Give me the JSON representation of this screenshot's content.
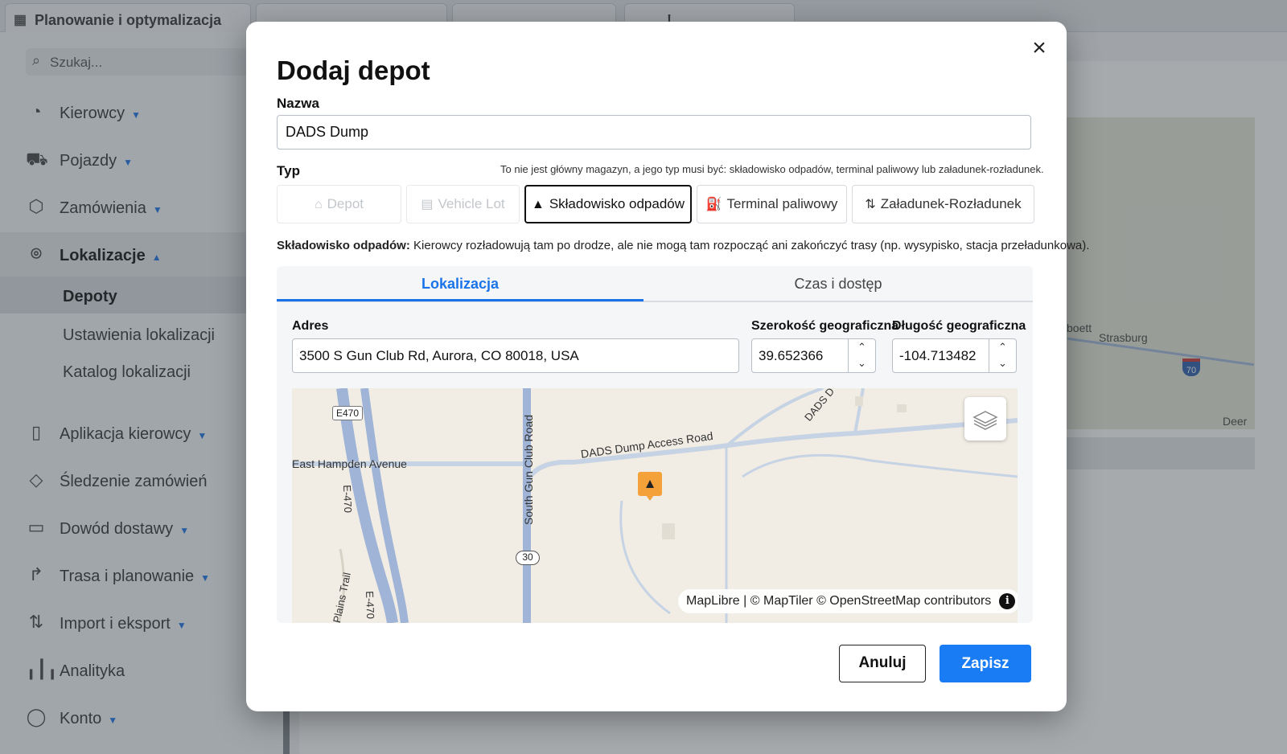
{
  "app": {
    "tabs": [
      {
        "label": "Planowanie i optymalizacja",
        "icon": "calendar-icon"
      },
      {
        "label": ""
      },
      {
        "label": ""
      },
      {
        "label": "!"
      }
    ],
    "search_placeholder": "Szukaj...",
    "nav": [
      {
        "label": "Kierowcy",
        "icon": "drivers-icon",
        "caret": "▼"
      },
      {
        "label": "Pojazdy",
        "icon": "truck-icon",
        "caret": "▼"
      },
      {
        "label": "Zamówienia",
        "icon": "box-icon",
        "caret": "▼"
      },
      {
        "label": "Lokalizacje",
        "icon": "location-pin-icon",
        "caret": "▲"
      },
      {
        "label": "Aplikacja kierowcy",
        "icon": "phone-icon",
        "caret": "▼"
      },
      {
        "label": "Śledzenie zamówień",
        "icon": "tag-icon",
        "caret": ""
      },
      {
        "label": "Dowód dostawy",
        "icon": "clipboard-icon",
        "caret": "▼"
      },
      {
        "label": "Trasa i planowanie",
        "icon": "route-icon",
        "caret": "▼"
      },
      {
        "label": "Import i eksport",
        "icon": "import-export-icon",
        "caret": "▼"
      },
      {
        "label": "Analityka",
        "icon": "chart-icon",
        "caret": ""
      },
      {
        "label": "Konto",
        "icon": "user-icon",
        "caret": "▼"
      }
    ],
    "subnav": [
      {
        "label": "Depoty",
        "active": true
      },
      {
        "label": "Ustawienia lokalizacji",
        "active": false
      },
      {
        "label": "Katalog lokalizacji",
        "active": false
      }
    ],
    "bg_map": {
      "labels": [
        "boett",
        "Strasburg",
        "Deer"
      ],
      "shield": "70"
    }
  },
  "modal": {
    "title": "Dodaj depot",
    "name_label": "Nazwa",
    "name_value": "DADS Dump",
    "type_label": "Typ",
    "type_hint": "To nie jest główny magazyn, a jego typ musi być: składowisko odpadów, terminal paliwowy lub załadunek-rozładunek.",
    "type_buttons": [
      {
        "label": "Depot",
        "icon": "home-icon",
        "state": "disabled"
      },
      {
        "label": "Vehicle Lot",
        "icon": "parking-icon",
        "state": "disabled"
      },
      {
        "label": "Składowisko odpadów",
        "icon": "landfill-icon",
        "state": "selected"
      },
      {
        "label": "Terminal paliwowy",
        "icon": "fuel-icon",
        "state": "normal"
      },
      {
        "label": "Załadunek-Rozładunek",
        "icon": "swap-icon",
        "state": "normal"
      }
    ],
    "type_desc_bold": "Składowisko odpadów:",
    "type_desc": " Kierowcy rozładowują tam po drodze, ale nie mogą tam rozpocząć ani zakończyć trasy (np. wysypisko, stacja przeładunkowa).",
    "tabs": [
      {
        "label": "Lokalizacja",
        "active": true
      },
      {
        "label": "Czas i dostęp",
        "active": false
      }
    ],
    "address_label": "Adres",
    "address_value": "3500 S Gun Club Rd, Aurora, CO 80018, USA",
    "lat_label": "Szerokość geograficzna",
    "lat_value": "39.652366",
    "lng_label": "Długość geograficzna",
    "lng_value": "-104.713482",
    "map": {
      "labels": {
        "e470": "E470",
        "e470_vertical": "E-470",
        "e470_vertical_b": "E-470",
        "hampden": "East Hampden Avenue",
        "gun_club": "South Gun Club Road",
        "access_road": "DADS Dump Access Road",
        "dads_d": "DADS D",
        "route30": "30",
        "plains_trail": "Plains Trail"
      },
      "attribution": "MapLibre | © MapTiler © OpenStreetMap contributors",
      "info": "i"
    },
    "cancel_label": "Anuluj",
    "save_label": "Zapisz",
    "close_symbol": "×"
  },
  "colors": {
    "accent": "#1a7cf5",
    "marker": "#f4a13a",
    "road": "#9fb9dc"
  }
}
